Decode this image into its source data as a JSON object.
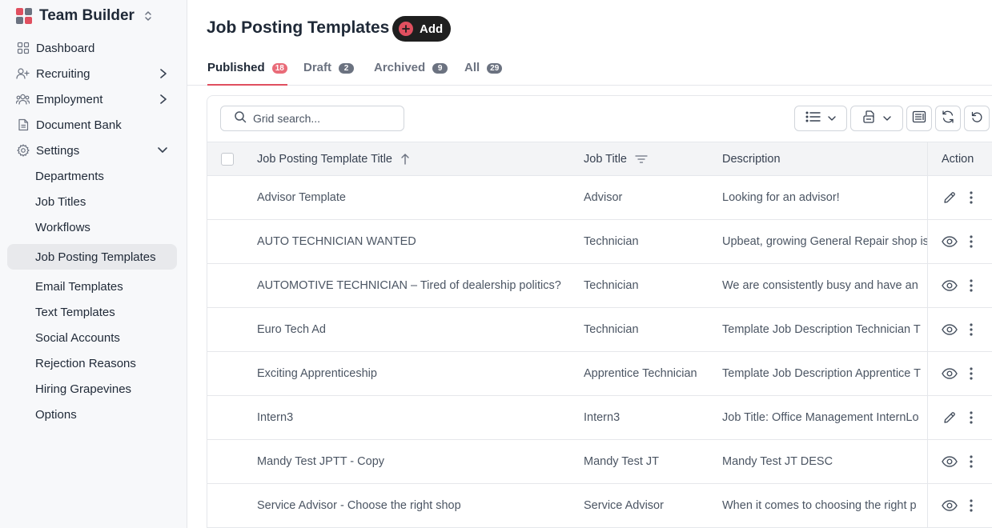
{
  "app": {
    "name": "Team Builder"
  },
  "sidebar": {
    "nav": [
      {
        "label": "Dashboard"
      },
      {
        "label": "Recruiting"
      },
      {
        "label": "Employment"
      },
      {
        "label": "Document Bank"
      },
      {
        "label": "Settings"
      }
    ],
    "settings_items": [
      {
        "label": "Departments"
      },
      {
        "label": "Job Titles"
      },
      {
        "label": "Workflows"
      },
      {
        "label": "Job Posting Templates"
      },
      {
        "label": "Email Templates"
      },
      {
        "label": "Text Templates"
      },
      {
        "label": "Social Accounts"
      },
      {
        "label": "Rejection Reasons"
      },
      {
        "label": "Hiring Grapevines"
      },
      {
        "label": "Options"
      }
    ]
  },
  "header": {
    "title": "Job Posting Templates",
    "add_label": "Add"
  },
  "tabs": [
    {
      "label": "Published",
      "count": "18"
    },
    {
      "label": "Draft",
      "count": "2"
    },
    {
      "label": "Archived",
      "count": "9"
    },
    {
      "label": "All",
      "count": "29"
    }
  ],
  "search": {
    "placeholder": "Grid search..."
  },
  "table": {
    "columns": {
      "title": "Job Posting Template Title",
      "job_title": "Job Title",
      "description": "Description",
      "action": "Action"
    },
    "rows": [
      {
        "title": "Advisor Template",
        "job_title": "Advisor",
        "description": "Looking for an advisor!",
        "action_icon": "pencil-icon"
      },
      {
        "title": "AUTO TECHNICIAN WANTED",
        "job_title": "Technician",
        "description": "Upbeat, growing General Repair shop is",
        "action_icon": "eye-icon"
      },
      {
        "title": "AUTOMOTIVE TECHNICIAN – Tired of dealership politics?",
        "job_title": "Technician",
        "description": "We are consistently busy and have an",
        "action_icon": "eye-icon"
      },
      {
        "title": "Euro Tech Ad",
        "job_title": "Technician",
        "description": "Template Job Description Technician T",
        "action_icon": "eye-icon"
      },
      {
        "title": "Exciting Apprenticeship",
        "job_title": "Apprentice Technician",
        "description": "Template Job Description Apprentice T",
        "action_icon": "eye-icon"
      },
      {
        "title": "Intern3",
        "job_title": "Intern3",
        "description": "Job Title: Office Management InternLo",
        "action_icon": "pencil-icon"
      },
      {
        "title": "Mandy Test JPTT - Copy",
        "job_title": "Mandy Test JT",
        "description": "Mandy Test JT DESC",
        "action_icon": "eye-icon"
      },
      {
        "title": "Service Advisor - Choose the right shop",
        "job_title": "Service Advisor",
        "description": "When it comes to choosing the right p",
        "action_icon": "eye-icon"
      }
    ]
  },
  "colors": {
    "accent": "#e04f5f",
    "sidebar_bg": "#f7f8fa",
    "header_bg": "#f3f4f6"
  }
}
